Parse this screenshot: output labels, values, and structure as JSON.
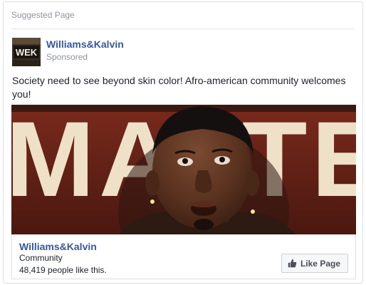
{
  "card": {
    "section_label": "Suggested Page",
    "avatar_text": "WEK",
    "page_name": "Williams&Kalvin",
    "sponsored": "Sponsored",
    "post_text": "Society need to see beyond skin color! Afro-american community welcomes you!",
    "media_background_text": "MATTER"
  },
  "footer": {
    "page_name": "Williams&Kalvin",
    "category": "Community",
    "likes": "48,419 people like this.",
    "like_button": "Like Page"
  },
  "colors": {
    "link": "#365899",
    "muted": "#90949c",
    "text": "#1d2129",
    "border": "#dddfe2"
  },
  "icons": {
    "like": "thumbs-up-icon"
  }
}
